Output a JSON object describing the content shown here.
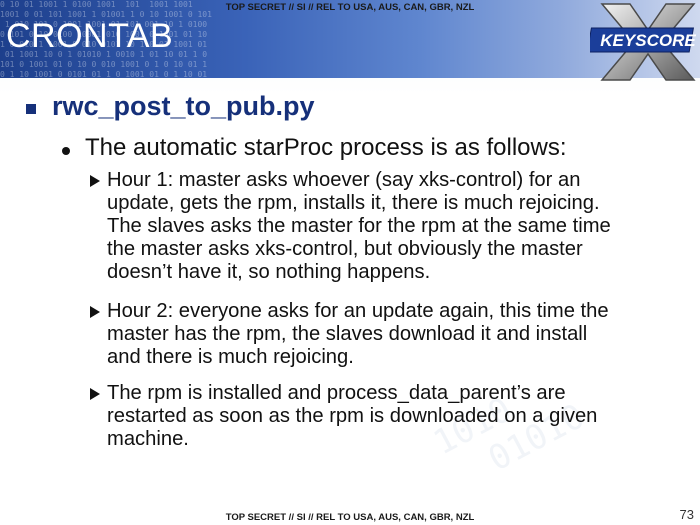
{
  "classification_top": "TOP SECRET // SI // REL TO USA, AUS, CAN, GBR, NZL",
  "classification_bottom": "TOP SECRET // SI // REL TO USA, AUS, CAN, GBR, NZL",
  "slide_title": "CRONTAB",
  "logo_text": "KEYSCORE",
  "level1": "rwc_post_to_pub.py",
  "level2": "The automatic starProc process is as follows:",
  "bullets": [
    "Hour 1: master asks whoever (say xks-control) for an\nupdate, gets the rpm, installs it, there is much rejoicing.\nThe slaves asks the master for the rpm at the same time\nthe master asks xks-control, but obviously the master\ndoesn’t have it, so nothing happens.",
    "Hour 2: everyone asks for an update again, this time the\nmaster has the rpm, the slaves download it and install\nand there is much rejoicing.",
    "The rpm is installed and process_data_parent’s are\nrestarted as soon as the rpm is downloaded on a given\nmachine."
  ],
  "page_number": "73",
  "colors": {
    "header": "#2f56a8",
    "accent": "#16307a",
    "text": "#111111"
  }
}
